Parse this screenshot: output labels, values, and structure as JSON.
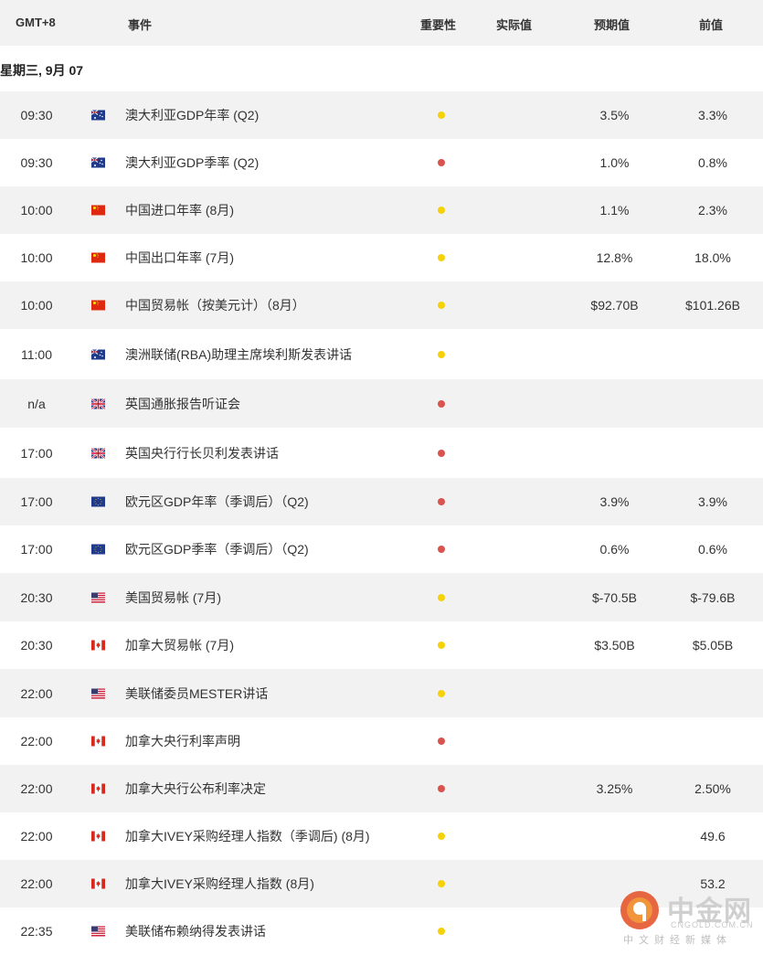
{
  "header": {
    "tz": "GMT+8",
    "event": "事件",
    "importance": "重要性",
    "actual": "实际值",
    "forecast": "预期值",
    "previous": "前值"
  },
  "date_label": "星期三, 9月 07",
  "colors": {
    "high": "#d9534f",
    "medium": "#f5d10a",
    "header_bg": "#f2f2f2",
    "alt_row": "#f2f2f2"
  },
  "rows": [
    {
      "time": "09:30",
      "country": "AU",
      "event": "澳大利亚GDP年率 (Q2)",
      "importance": "medium",
      "forecast": "3.5%",
      "previous": "3.3%"
    },
    {
      "time": "09:30",
      "country": "AU",
      "event": "澳大利亚GDP季率 (Q2)",
      "importance": "high",
      "forecast": "1.0%",
      "previous": "0.8%"
    },
    {
      "time": "10:00",
      "country": "CN",
      "event": "中国进口年率 (8月)",
      "importance": "medium",
      "forecast": "1.1%",
      "previous": "2.3%"
    },
    {
      "time": "10:00",
      "country": "CN",
      "event": "中国出口年率 (7月)",
      "importance": "medium",
      "forecast": "12.8%",
      "previous": "18.0%"
    },
    {
      "time": "10:00",
      "country": "CN",
      "event": "中国贸易帐（按美元计）（8月）",
      "importance": "medium",
      "forecast": "$92.70B",
      "previous": "$101.26B"
    },
    {
      "time": "11:00",
      "country": "AU",
      "event": "澳洲联储(RBA)助理主席埃利斯发表讲话",
      "importance": "medium",
      "forecast": "",
      "previous": ""
    },
    {
      "time": "n/a",
      "country": "GB",
      "event": "英国通胀报告听证会",
      "importance": "high",
      "forecast": "",
      "previous": ""
    },
    {
      "time": "17:00",
      "country": "GB",
      "event": "英国央行行长贝利发表讲话",
      "importance": "high",
      "forecast": "",
      "previous": ""
    },
    {
      "time": "17:00",
      "country": "EU",
      "event": "欧元区GDP年率（季调后）（Q2)",
      "importance": "high",
      "forecast": "3.9%",
      "previous": "3.9%"
    },
    {
      "time": "17:00",
      "country": "EU",
      "event": "欧元区GDP季率（季调后）（Q2)",
      "importance": "high",
      "forecast": "0.6%",
      "previous": "0.6%"
    },
    {
      "time": "20:30",
      "country": "US",
      "event": "美国贸易帐 (7月)",
      "importance": "medium",
      "forecast": "$-70.5B",
      "previous": "$-79.6B"
    },
    {
      "time": "20:30",
      "country": "CA",
      "event": "加拿大贸易帐 (7月)",
      "importance": "medium",
      "forecast": "$3.50B",
      "previous": "$5.05B"
    },
    {
      "time": "22:00",
      "country": "US",
      "event": "美联储委员MESTER讲话",
      "importance": "medium",
      "forecast": "",
      "previous": ""
    },
    {
      "time": "22:00",
      "country": "CA",
      "event": "加拿大央行利率声明",
      "importance": "high",
      "forecast": "",
      "previous": ""
    },
    {
      "time": "22:00",
      "country": "CA",
      "event": "加拿大央行公布利率决定",
      "importance": "high",
      "forecast": "3.25%",
      "previous": "2.50%"
    },
    {
      "time": "22:00",
      "country": "CA",
      "event": "加拿大IVEY采购经理人指数（季调后) (8月)",
      "importance": "medium",
      "forecast": "",
      "previous": "49.6"
    },
    {
      "time": "22:00",
      "country": "CA",
      "event": "加拿大IVEY采购经理人指数 (8月)",
      "importance": "medium",
      "forecast": "",
      "previous": "53.2"
    },
    {
      "time": "22:35",
      "country": "US",
      "event": "美联储布赖纳得发表讲话",
      "importance": "medium",
      "forecast": "",
      "previous": ""
    }
  ],
  "watermark": {
    "brand": "中金网",
    "site": "CNGOLD.COM.CN",
    "slogan": "中文财经新媒体"
  }
}
